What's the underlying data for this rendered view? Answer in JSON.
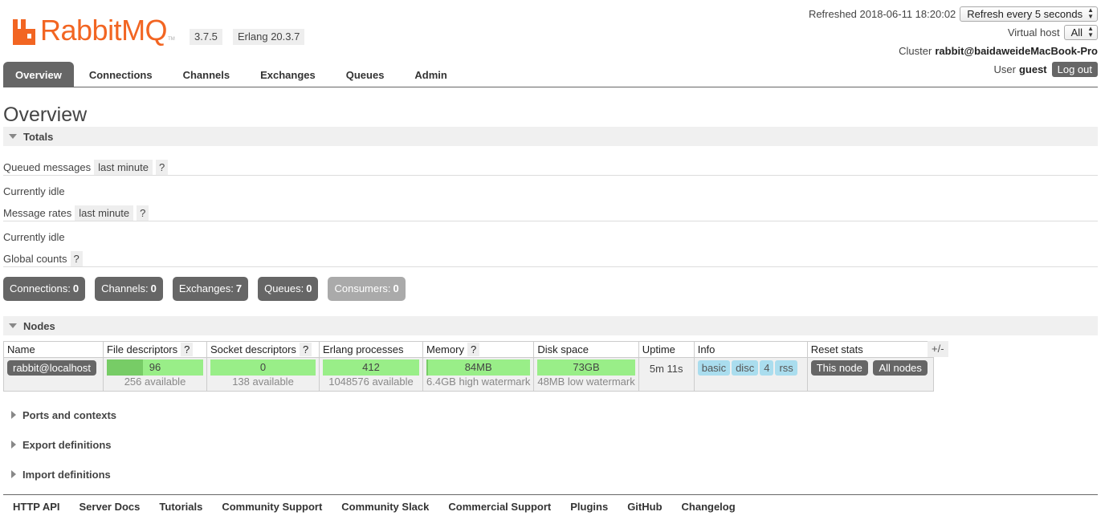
{
  "brand": {
    "name": "RabbitMQ",
    "tm": "TM",
    "version": "3.7.5",
    "erlang": "Erlang 20.3.7",
    "color": "#f26522"
  },
  "header": {
    "refreshed_label": "Refreshed 2018-06-11 18:20:02",
    "refresh_select": "Refresh every 5 seconds",
    "vhost_label": "Virtual host",
    "vhost_select": "All",
    "cluster_label": "Cluster",
    "cluster_name": "rabbit@baidaweideMacBook-Pro",
    "user_label": "User",
    "user_name": "guest",
    "logout": "Log out"
  },
  "tabs": [
    "Overview",
    "Connections",
    "Channels",
    "Exchanges",
    "Queues",
    "Admin"
  ],
  "page_title": "Overview",
  "totals": {
    "header": "Totals",
    "queued_label": "Queued messages",
    "queued_period": "last minute",
    "help": "?",
    "idle1": "Currently idle",
    "rates_label": "Message rates",
    "rates_period": "last minute",
    "idle2": "Currently idle",
    "global_label": "Global counts"
  },
  "counts": [
    {
      "label": "Connections:",
      "value": "0"
    },
    {
      "label": "Channels:",
      "value": "0"
    },
    {
      "label": "Exchanges:",
      "value": "7"
    },
    {
      "label": "Queues:",
      "value": "0"
    },
    {
      "label": "Consumers:",
      "value": "0"
    }
  ],
  "nodes": {
    "header": "Nodes",
    "columns": [
      "Name",
      "File descriptors",
      "Socket descriptors",
      "Erlang processes",
      "Memory",
      "Disk space",
      "Uptime",
      "Info",
      "Reset stats"
    ],
    "toggle": "+/-",
    "row": {
      "name": "rabbit@localhost",
      "fd_value": "96",
      "fd_avail": "256 available",
      "fd_fraction": 0.375,
      "sd_value": "0",
      "sd_avail": "138 available",
      "ep_value": "412",
      "ep_avail": "1048576 available",
      "mem_value": "84MB",
      "mem_avail": "6.4GB high watermark",
      "mem_fraction": 0.013,
      "disk_value": "73GB",
      "disk_avail": "48MB low watermark",
      "uptime": "5m 11s",
      "info": [
        "basic",
        "disc",
        "4",
        "rss"
      ],
      "reset_this": "This node",
      "reset_all": "All nodes"
    }
  },
  "collapsed_sections": [
    "Ports and contexts",
    "Export definitions",
    "Import definitions"
  ],
  "footer": [
    "HTTP API",
    "Server Docs",
    "Tutorials",
    "Community Support",
    "Community Slack",
    "Commercial Support",
    "Plugins",
    "GitHub",
    "Changelog"
  ]
}
